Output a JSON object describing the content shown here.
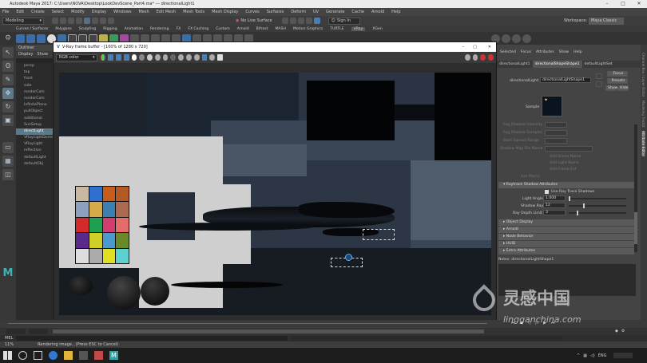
{
  "window": {
    "title": "Autodesk Maya 2017: C:\\Users\\NOVA\\Desktop\\LookDevScene_Part4.ma* --- directionalLight1"
  },
  "menu": [
    "File",
    "Edit",
    "Create",
    "Select",
    "Modify",
    "Display",
    "Windows",
    "Mesh",
    "Edit Mesh",
    "Mesh Tools",
    "Mesh Display",
    "Curves",
    "Surfaces",
    "Deform",
    "UV",
    "Generate",
    "Cache",
    "Arnold",
    "Help"
  ],
  "modebar": {
    "mode": "Modeling",
    "live_surface": "No Live Surface",
    "sign_in": "Sign In",
    "workspace_label": "Workspace:",
    "workspace": "Maya Classic"
  },
  "shelf_tabs": [
    "Curves / Surfaces",
    "Polygons",
    "Sculpting",
    "Rigging",
    "Animation",
    "Rendering",
    "FX",
    "FX Caching",
    "Custom",
    "Arnold",
    "Bifrost",
    "MASH",
    "Motion Graphics",
    "TURTLE",
    "VRay",
    "XGen"
  ],
  "outliner": {
    "title": "Outliner",
    "menu": [
      "Display",
      "Show"
    ],
    "items": [
      "persp",
      "top",
      "front",
      "side",
      "renderCam",
      "renderCam",
      "InfinitePlane",
      "pullObject",
      "additional",
      "SunSetup",
      "directLight",
      "VRayLightDome",
      "VRayLight",
      "reflection",
      "defaultLight",
      "defaultObj"
    ]
  },
  "vfb": {
    "title": "V-Ray frame buffer - [100% of 1280 x 720]",
    "channel": "RGB color"
  },
  "attr_editor": {
    "menu": [
      "Selected",
      "Focus",
      "Attributes",
      "Show",
      "Help"
    ],
    "tabs": [
      "directionalLight1",
      "directionalShapeShape1",
      "defaultLightSet"
    ],
    "node_label": "directionalLight:",
    "node_value": "directionalLightShape1",
    "focus": "Focus",
    "presets": "Presets",
    "show": "Show",
    "hide": "Hide",
    "sample": "Sample",
    "dimmed": [
      "Fog Shadow Intensity",
      "Fog Shadow Samples",
      "Start Spread Range",
      "Shadow Map File Name",
      "Add Scene Name",
      "Add Light Name",
      "Add Frame Ext",
      "Use Macro"
    ],
    "raytrace_section": "Raytrace Shadow Attributes",
    "use_ray_trace": "Use Ray Trace Shadows",
    "light_angle_label": "Light Angle",
    "light_angle": "1.000",
    "shadow_rays_label": "Shadow Rays",
    "shadow_rays": "12",
    "ray_depth_label": "Ray Depth Limit",
    "ray_depth": "3",
    "sections": [
      "Object Display",
      "Arnold",
      "Node Behavior",
      "UUID",
      "Extra Attributes"
    ],
    "notes": "Notes: directionalLightShape1"
  },
  "right_strip": [
    "Channel Box / Layer Editor",
    "Modeling Toolkit",
    "Attribute Editor"
  ],
  "cmd": {
    "lang": "MEL"
  },
  "help": {
    "progress": "11%",
    "message": "Rendering image...(Press ESC to Cancel)"
  },
  "taskbar": {
    "lang": "ENG"
  },
  "watermark": {
    "cn": "灵感中国",
    "url": "lingganchina.com"
  },
  "colors": {
    "maya_bg": "#444444",
    "accent": "#4a7fb5",
    "selected": "#5d7a8a",
    "vfb_dark": "#18222d"
  }
}
